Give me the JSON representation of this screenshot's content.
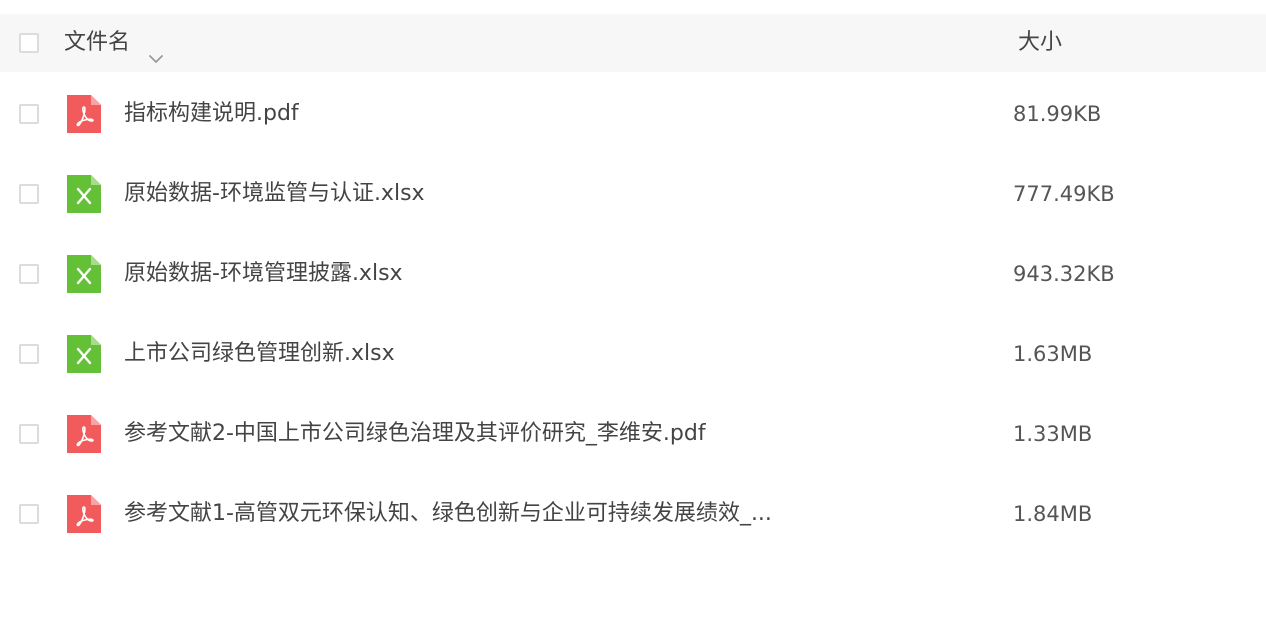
{
  "header": {
    "name_label": "文件名",
    "size_label": "大小",
    "sort_icon": "chevron-down-icon"
  },
  "colors": {
    "pdf": "#f25b5b",
    "xlsx": "#63c037",
    "header_bg": "#f7f7f7",
    "checkbox_border": "#dcdcdc"
  },
  "files": [
    {
      "name": "指标构建说明.pdf",
      "size": "81.99KB",
      "type": "pdf",
      "icon": "pdf-file-icon"
    },
    {
      "name": "原始数据-环境监管与认证.xlsx",
      "size": "777.49KB",
      "type": "xlsx",
      "icon": "excel-file-icon"
    },
    {
      "name": "原始数据-环境管理披露.xlsx",
      "size": "943.32KB",
      "type": "xlsx",
      "icon": "excel-file-icon"
    },
    {
      "name": "上市公司绿色管理创新.xlsx",
      "size": "1.63MB",
      "type": "xlsx",
      "icon": "excel-file-icon"
    },
    {
      "name": "参考文献2-中国上市公司绿色治理及其评价研究_李维安.pdf",
      "size": "1.33MB",
      "type": "pdf",
      "icon": "pdf-file-icon"
    },
    {
      "name": "参考文献1-高管双元环保认知、绿色创新与企业可持续发展绩效_...",
      "size": "1.84MB",
      "type": "pdf",
      "icon": "pdf-file-icon"
    }
  ]
}
